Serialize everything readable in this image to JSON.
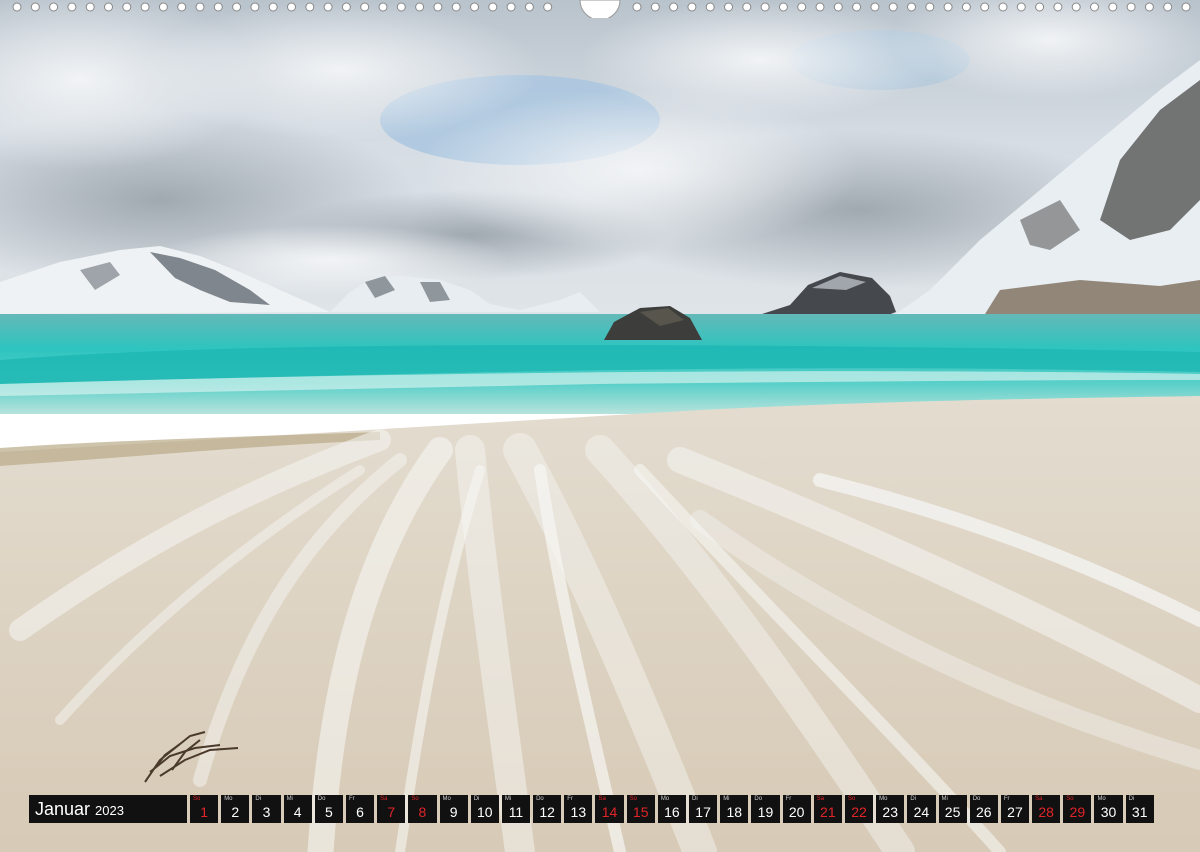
{
  "calendar": {
    "month": "Januar",
    "year": "2023",
    "weekend_color": "#e0242a",
    "days": [
      {
        "wd": "So",
        "n": "1",
        "weekend": true
      },
      {
        "wd": "Mo",
        "n": "2",
        "weekend": false
      },
      {
        "wd": "Di",
        "n": "3",
        "weekend": false
      },
      {
        "wd": "Mi",
        "n": "4",
        "weekend": false
      },
      {
        "wd": "Do",
        "n": "5",
        "weekend": false
      },
      {
        "wd": "Fr",
        "n": "6",
        "weekend": false
      },
      {
        "wd": "Sa",
        "n": "7",
        "weekend": true
      },
      {
        "wd": "So",
        "n": "8",
        "weekend": true
      },
      {
        "wd": "Mo",
        "n": "9",
        "weekend": false
      },
      {
        "wd": "Di",
        "n": "10",
        "weekend": false
      },
      {
        "wd": "Mi",
        "n": "11",
        "weekend": false
      },
      {
        "wd": "Do",
        "n": "12",
        "weekend": false
      },
      {
        "wd": "Fr",
        "n": "13",
        "weekend": false
      },
      {
        "wd": "Sa",
        "n": "14",
        "weekend": true
      },
      {
        "wd": "So",
        "n": "15",
        "weekend": true
      },
      {
        "wd": "Mo",
        "n": "16",
        "weekend": false
      },
      {
        "wd": "Di",
        "n": "17",
        "weekend": false
      },
      {
        "wd": "Mi",
        "n": "18",
        "weekend": false
      },
      {
        "wd": "Do",
        "n": "19",
        "weekend": false
      },
      {
        "wd": "Fr",
        "n": "20",
        "weekend": false
      },
      {
        "wd": "Sa",
        "n": "21",
        "weekend": true
      },
      {
        "wd": "So",
        "n": "22",
        "weekend": true
      },
      {
        "wd": "Mo",
        "n": "23",
        "weekend": false
      },
      {
        "wd": "Di",
        "n": "24",
        "weekend": false
      },
      {
        "wd": "Mi",
        "n": "25",
        "weekend": false
      },
      {
        "wd": "Do",
        "n": "26",
        "weekend": false
      },
      {
        "wd": "Fr",
        "n": "27",
        "weekend": false
      },
      {
        "wd": "Sa",
        "n": "28",
        "weekend": true
      },
      {
        "wd": "So",
        "n": "29",
        "weekend": true
      },
      {
        "wd": "Mo",
        "n": "30",
        "weekend": false
      },
      {
        "wd": "Di",
        "n": "31",
        "weekend": false
      }
    ]
  },
  "photo": {
    "subject": "coastal-beach-landscape",
    "colors": {
      "sky": "#c9d3dc",
      "cloud": "#eef1f4",
      "sea": "#2fc2bd",
      "sand": "#dcd2c2",
      "foam": "#f4f4f2"
    }
  },
  "binding": {
    "icon": "spiral-binding-icon"
  }
}
